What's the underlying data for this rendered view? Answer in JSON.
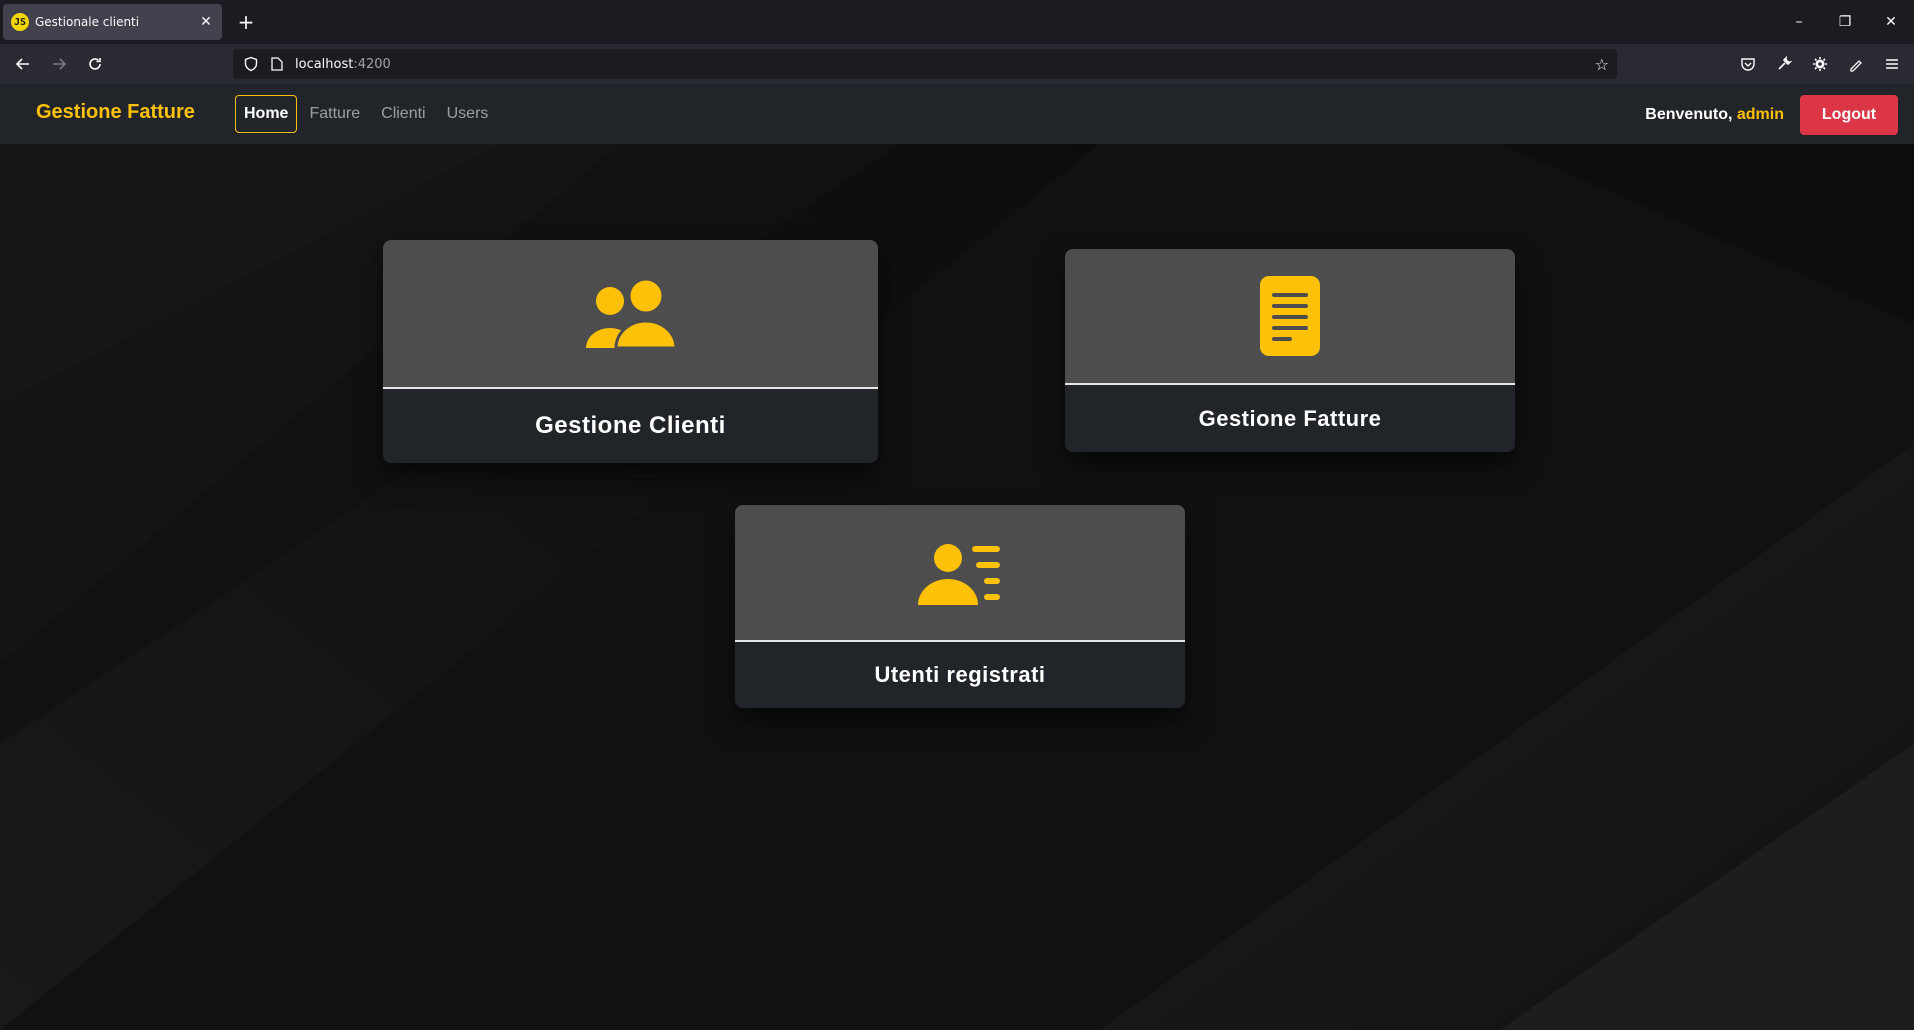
{
  "browser": {
    "tab_title": "Gestionale clienti",
    "tab_close": "✕",
    "new_tab": "+",
    "url_host": "localhost",
    "url_port": ":4200",
    "window_controls": [
      "–",
      "❐",
      "✕"
    ]
  },
  "app": {
    "brand": "Gestione Fatture",
    "nav": [
      {
        "label": "Home",
        "active": true
      },
      {
        "label": "Fatture",
        "active": false
      },
      {
        "label": "Clienti",
        "active": false
      },
      {
        "label": "Users",
        "active": false
      }
    ],
    "welcome_prefix": "Benvenuto,",
    "username": "admin",
    "logout_label": "Logout"
  },
  "cards": [
    {
      "title": "Gestione Clienti",
      "icon": "users-icon"
    },
    {
      "title": "Gestione Fatture",
      "icon": "document-icon"
    },
    {
      "title": "Utenti registrati",
      "icon": "user-list-icon"
    }
  ],
  "colors": {
    "accent": "#ffc107",
    "danger": "#dc3545",
    "navbar": "#212529",
    "card_top": "#4d4d4d"
  }
}
